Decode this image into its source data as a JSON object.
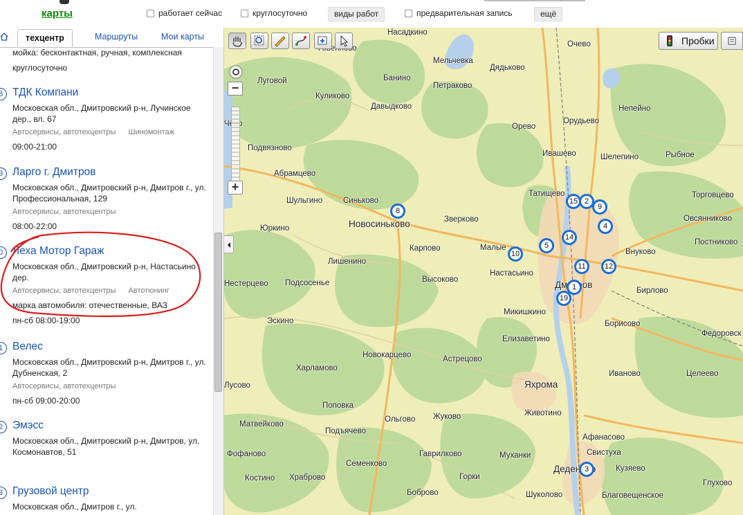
{
  "header": {
    "brand": "карты",
    "filters": [
      {
        "label": "работает сейчас"
      },
      {
        "label": "круглосуточно"
      },
      {
        "label": "предварительная запись"
      }
    ],
    "work_types_button": "виды работ",
    "more_button": "ещё"
  },
  "sidebar": {
    "tabs": [
      "техцентр",
      "Маршруты",
      "Мои карты"
    ],
    "top_service_line": "мойка: бесконтактная, ручная, комплексная",
    "top_hours": "круглосуточно",
    "items": [
      {
        "num": "8",
        "title": "ТДК Компани",
        "address": "Московская обл., Дмитровский р-н, Лучинское дер., вл. 67",
        "categories": [
          "Автосервисы, автотехцентры",
          "Шиномонтаж"
        ],
        "extra": "",
        "hours": "09:00-21:00"
      },
      {
        "num": "9",
        "title": "Ларго г. Дмитров",
        "address": "Московская обл., Дмитровский р-н, Дмитров г., ул. Профессиональная, 129",
        "categories": [
          "Автосервисы, автотехцентры"
        ],
        "extra": "",
        "hours": "08:00-22:00"
      },
      {
        "num": "0",
        "title": "Леха Мотор Гараж",
        "address": "Московская обл., Дмитровский р-н, Настасьино дер.",
        "categories": [
          "Автосервисы, автотехцентры",
          "Автотюнинг"
        ],
        "extra": "марка автомобиля: отечественные, ВАЗ",
        "hours": "пн-сб 08:00-19:00"
      },
      {
        "num": "1",
        "title": "Велес",
        "address": "Московская обл., Дмитровский р-н, Дмитров г., ул. Дубненская, 2",
        "categories": [
          "Автосервисы, автотехцентры"
        ],
        "extra": "",
        "hours": "пн-сб 09:00-20:00"
      },
      {
        "num": "2",
        "title": "Эмэсс",
        "address": "Московская обл., Дмитровский р-н, Дмитров, ул. Космонавтов, 51",
        "categories": [],
        "extra": "",
        "hours": ""
      },
      {
        "num": "3",
        "title": "Грузовой центр",
        "address": "Московская обл., Дмитров г., ул.",
        "categories": [],
        "extra": "",
        "hours": ""
      }
    ]
  },
  "map": {
    "traffic_button": "Пробки",
    "zoom_in": "+",
    "zoom_out": "−",
    "places": [
      {
        "name": "Насадкино"
      },
      {
        "name": "Говенново"
      },
      {
        "name": "Мельчевка"
      },
      {
        "name": "Очево"
      },
      {
        "name": "Дядьково"
      },
      {
        "name": "Луговой"
      },
      {
        "name": "Банино"
      },
      {
        "name": "Петраково"
      },
      {
        "name": "Куликово"
      },
      {
        "name": "Давыдково"
      },
      {
        "name": "Непейно"
      },
      {
        "name": "Чёво"
      },
      {
        "name": "Орудьево"
      },
      {
        "name": "Орево"
      },
      {
        "name": "Подвязново"
      },
      {
        "name": "Ивашево"
      },
      {
        "name": "Шелепино"
      },
      {
        "name": "Рыбное"
      },
      {
        "name": "Абрамцево"
      },
      {
        "name": "Татищево"
      },
      {
        "name": "Торговцево"
      },
      {
        "name": "Шульгино"
      },
      {
        "name": "Синьково"
      },
      {
        "name": "Зверково"
      },
      {
        "name": "Овсянниково"
      },
      {
        "name": "Новосиньково"
      },
      {
        "name": "Юркино"
      },
      {
        "name": "Постниково"
      },
      {
        "name": "Карпово"
      },
      {
        "name": "Малые"
      },
      {
        "name": "Внуково"
      },
      {
        "name": "Лишенино"
      },
      {
        "name": "Настасьино"
      },
      {
        "name": "Высоково"
      },
      {
        "name": "Подсосенье"
      },
      {
        "name": "Дмитров"
      },
      {
        "name": "Бирлово"
      },
      {
        "name": "Нестерцево"
      },
      {
        "name": "Микишкино"
      },
      {
        "name": "Борисово"
      },
      {
        "name": "Эскино"
      },
      {
        "name": "Федоровск"
      },
      {
        "name": "Елизаветино"
      },
      {
        "name": "Новокарцево"
      },
      {
        "name": "Харламово"
      },
      {
        "name": "Астрецово"
      },
      {
        "name": "Иваново"
      },
      {
        "name": "Яхрома"
      },
      {
        "name": "Целеево"
      },
      {
        "name": "Лусово"
      },
      {
        "name": "Поповка"
      },
      {
        "name": "Жуково"
      },
      {
        "name": "Ольгово"
      },
      {
        "name": "Животино"
      },
      {
        "name": "Матвейково"
      },
      {
        "name": "Подъячево"
      },
      {
        "name": "Афанасово"
      },
      {
        "name": "Свистуха"
      },
      {
        "name": "Фофаново"
      },
      {
        "name": "Семенково"
      },
      {
        "name": "Гаврилково"
      },
      {
        "name": "Муханки"
      },
      {
        "name": "Костино"
      },
      {
        "name": "Храброво"
      },
      {
        "name": "Горки"
      },
      {
        "name": "Деденево"
      },
      {
        "name": "Кузяево"
      },
      {
        "name": "Боброво"
      },
      {
        "name": "Шуколово"
      },
      {
        "name": "Благовещенское"
      },
      {
        "name": "Глухово"
      }
    ],
    "pins": [
      "8",
      "15",
      "2",
      "9",
      "4",
      "14",
      "5",
      "10",
      "11",
      "12",
      "1",
      "19",
      "3"
    ]
  }
}
